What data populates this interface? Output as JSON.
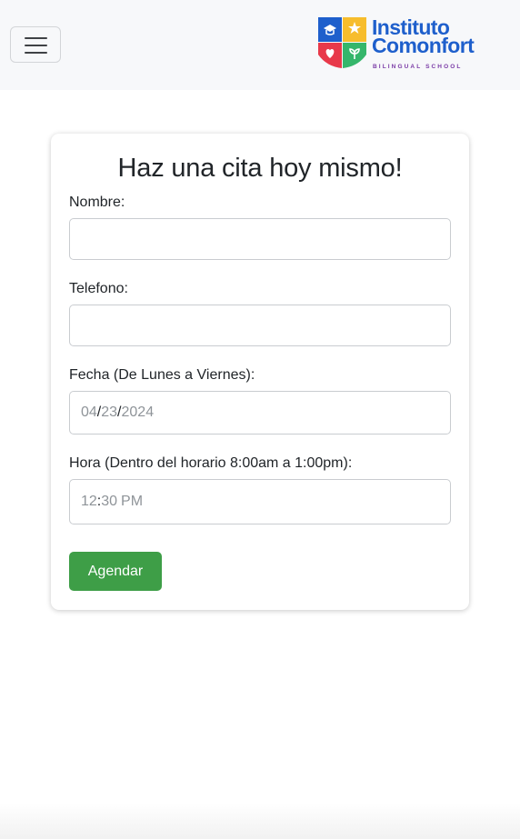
{
  "navbar": {
    "toggle_icon": "hamburger-icon",
    "logo": {
      "line1": "Instituto",
      "line2": "Comonfort",
      "subtitle": "BILINGUAL SCHOOL",
      "colors": {
        "blue": "#1e5fcc",
        "yellow": "#f7bd2c",
        "red": "#e8394a",
        "green": "#35b66b",
        "purple": "#7a3ba6"
      }
    },
    "background": "#f7f8fa"
  },
  "form": {
    "title": "Haz una cita hoy mismo!",
    "fields": {
      "nombre": {
        "label": "Nombre:",
        "value": ""
      },
      "telefono": {
        "label": "Telefono:",
        "value": ""
      },
      "fecha": {
        "label": "Fecha (De Lunes a Viernes):",
        "month": "04",
        "day": "23",
        "year": "2024",
        "separator": "/"
      },
      "hora": {
        "label": "Hora (Dentro del horario 8:00am a 1:00pm):",
        "hour": "12",
        "minute": "30",
        "period": "PM",
        "separator": ":"
      }
    },
    "submit_label": "Agendar",
    "submit_color": "#3e9e47"
  }
}
